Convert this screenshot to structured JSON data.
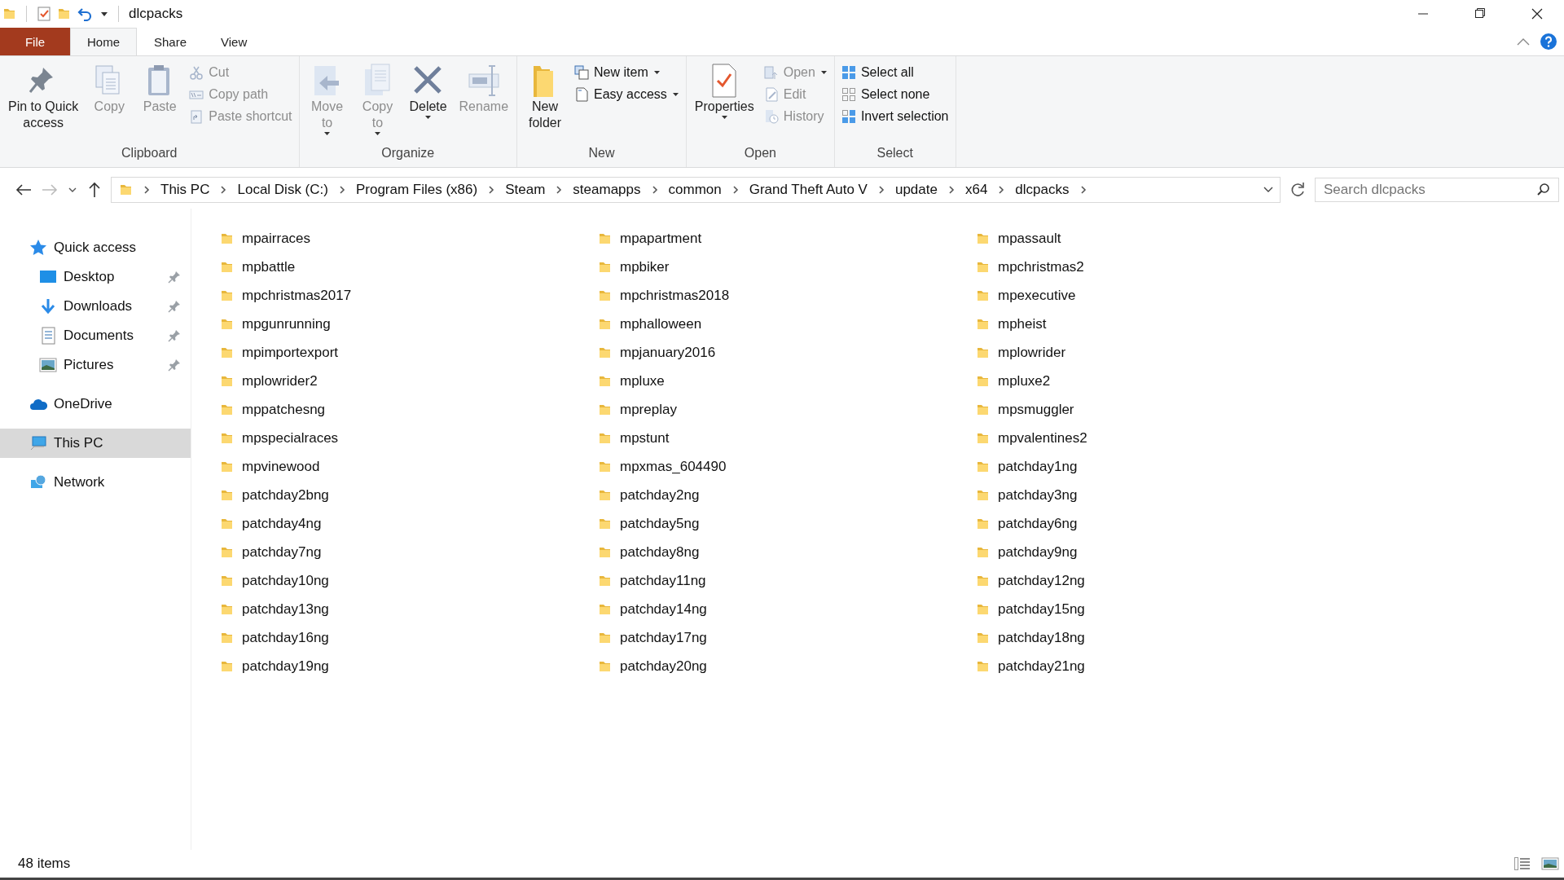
{
  "window": {
    "title": "dlcpacks"
  },
  "ribbon_tabs": [
    {
      "label": "File",
      "kind": "file",
      "selected": false
    },
    {
      "label": "Home",
      "kind": "tab",
      "selected": true
    },
    {
      "label": "Share",
      "kind": "tab",
      "selected": false
    },
    {
      "label": "View",
      "kind": "tab",
      "selected": false
    }
  ],
  "ribbon_groups": [
    {
      "label": "Clipboard",
      "items": [
        {
          "kind": "large",
          "label": "Pin to Quick\naccess",
          "disabled": false,
          "dropdown": false
        },
        {
          "kind": "large",
          "label": "Copy",
          "disabled": true,
          "dropdown": false
        },
        {
          "kind": "large",
          "label": "Paste",
          "disabled": true,
          "dropdown": false
        },
        {
          "kind": "small",
          "label": "Cut",
          "disabled": true,
          "dropdown": false
        },
        {
          "kind": "small",
          "label": "Copy path",
          "disabled": true,
          "dropdown": false
        },
        {
          "kind": "small",
          "label": "Paste shortcut",
          "disabled": true,
          "dropdown": false
        }
      ]
    },
    {
      "label": "Organize",
      "items": [
        {
          "kind": "large",
          "label": "Move\nto",
          "disabled": true,
          "dropdown": true
        },
        {
          "kind": "large",
          "label": "Copy\nto",
          "disabled": true,
          "dropdown": true
        },
        {
          "kind": "large",
          "label": "Delete",
          "disabled": false,
          "dropdown": true
        },
        {
          "kind": "large",
          "label": "Rename",
          "disabled": true,
          "dropdown": false
        }
      ]
    },
    {
      "label": "New",
      "items": [
        {
          "kind": "large",
          "label": "New\nfolder",
          "disabled": false,
          "dropdown": false
        },
        {
          "kind": "small",
          "label": "New item",
          "disabled": false,
          "dropdown": true
        },
        {
          "kind": "small",
          "label": "Easy access",
          "disabled": false,
          "dropdown": true
        }
      ]
    },
    {
      "label": "Open",
      "items": [
        {
          "kind": "large",
          "label": "Properties",
          "disabled": false,
          "dropdown": true
        },
        {
          "kind": "small",
          "label": "Open",
          "disabled": true,
          "dropdown": true
        },
        {
          "kind": "small",
          "label": "Edit",
          "disabled": true,
          "dropdown": false
        },
        {
          "kind": "small",
          "label": "History",
          "disabled": true,
          "dropdown": false
        }
      ]
    },
    {
      "label": "Select",
      "items": [
        {
          "kind": "small",
          "label": "Select all",
          "disabled": false,
          "dropdown": false
        },
        {
          "kind": "small",
          "label": "Select none",
          "disabled": false,
          "dropdown": false
        },
        {
          "kind": "small",
          "label": "Invert selection",
          "disabled": false,
          "dropdown": false
        }
      ]
    }
  ],
  "address_bar": {
    "path": [
      "This PC",
      "Local Disk (C:)",
      "Program Files (x86)",
      "Steam",
      "steamapps",
      "common",
      "Grand Theft Auto V",
      "update",
      "x64",
      "dlcpacks"
    ]
  },
  "search": {
    "placeholder": "Search dlcpacks"
  },
  "sidebar": {
    "items": [
      {
        "label": "Quick access",
        "selected": false,
        "children": [
          {
            "label": "Desktop",
            "selected": false,
            "pinned": true
          },
          {
            "label": "Downloads",
            "selected": false,
            "pinned": true
          },
          {
            "label": "Documents",
            "selected": false,
            "pinned": true
          },
          {
            "label": "Pictures",
            "selected": false,
            "pinned": true
          }
        ]
      },
      {
        "label": "OneDrive",
        "selected": false
      },
      {
        "label": "This PC",
        "selected": true
      },
      {
        "label": "Network",
        "selected": false
      }
    ]
  },
  "files": [
    "mpairraces",
    "mpapartment",
    "mpassault",
    "mpbattle",
    "mpbiker",
    "mpchristmas2",
    "mpchristmas2017",
    "mpchristmas2018",
    "mpexecutive",
    "mpgunrunning",
    "mphalloween",
    "mpheist",
    "mpimportexport",
    "mpjanuary2016",
    "mplowrider",
    "mplowrider2",
    "mpluxe",
    "mpluxe2",
    "mppatchesng",
    "mpreplay",
    "mpsmuggler",
    "mpspecialraces",
    "mpstunt",
    "mpvalentines2",
    "mpvinewood",
    "mpxmas_604490",
    "patchday1ng",
    "patchday2bng",
    "patchday2ng",
    "patchday3ng",
    "patchday4ng",
    "patchday5ng",
    "patchday6ng",
    "patchday7ng",
    "patchday8ng",
    "patchday9ng",
    "patchday10ng",
    "patchday11ng",
    "patchday12ng",
    "patchday13ng",
    "patchday14ng",
    "patchday15ng",
    "patchday16ng",
    "patchday17ng",
    "patchday18ng",
    "patchday19ng",
    "patchday20ng",
    "patchday21ng"
  ],
  "status_bar": {
    "item_count": "48 items"
  }
}
